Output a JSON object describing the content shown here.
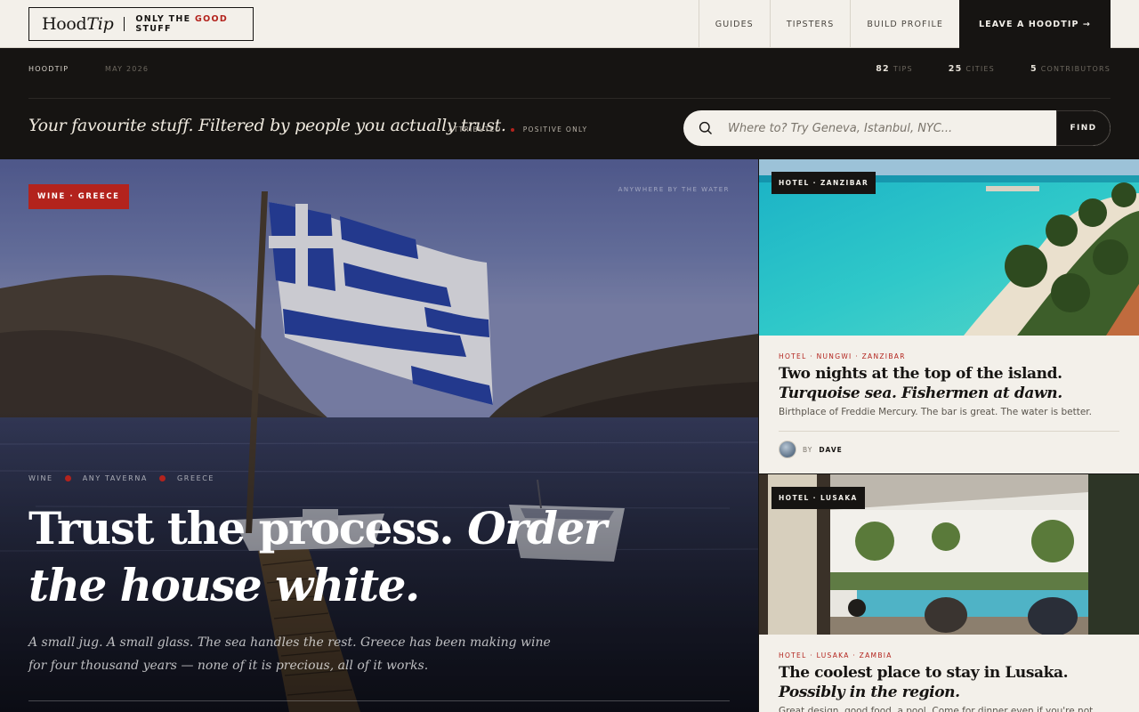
{
  "nav": {
    "logo_word": "Hood",
    "logo_word_italic": "Tip",
    "logo_tag_before": "ONLY THE ",
    "logo_tag_accent": "GOOD",
    "logo_tag_after": " STUFF",
    "items": [
      "GUIDES",
      "TIPSTERS",
      "BUILD PROFILE"
    ],
    "cta": "LEAVE A HOODTIP →"
  },
  "meta": {
    "brand": "HOODTIP",
    "date": "MAY 2026",
    "stats": [
      {
        "value": "82",
        "label": "TIPS"
      },
      {
        "value": "25",
        "label": "CITIES"
      },
      {
        "value": "5",
        "label": "CONTRIBUTORS"
      }
    ],
    "tagline": "Your favourite stuff. Filtered by people you actually trust.",
    "flags": [
      "ATTRIBUTED",
      "POSITIVE ONLY"
    ]
  },
  "search": {
    "placeholder": "Where to? Try Geneva, Istanbul, NYC...",
    "button": "FIND"
  },
  "hero": {
    "badge": "WINE · GREECE",
    "corner": "ANYWHERE BY THE WATER",
    "crumbs": [
      "WINE",
      "ANY TAVERNA",
      "GREECE"
    ],
    "title_regular": "Trust the process. ",
    "title_italic": "Order the house white.",
    "subtitle": "A small jug. A small glass. The sea handles the rest. Greece has been making wine for four thousand years — none of it is precious, all of it works."
  },
  "cards": [
    {
      "badge": "HOTEL · ZANZIBAR",
      "kicker": "HOTEL · NUNGWI · ZANZIBAR",
      "title_regular": "Two nights at the top of the island. ",
      "title_italic": "Turquoise sea. Fishermen at dawn.",
      "desc": "Birthplace of Freddie Mercury. The bar is great. The water is better.",
      "by": "BY",
      "author": "DAVE"
    },
    {
      "badge": "HOTEL · LUSAKA",
      "kicker": "HOTEL · LUSAKA · ZAMBIA",
      "title_regular": "The coolest place to stay in Lusaka. ",
      "title_italic": "Possibly in the region.",
      "desc": "Great design, good food, a pool. Come for dinner even if you're not"
    }
  ],
  "colors": {
    "accent_red": "#b3231d",
    "ink": "#161412",
    "paper": "#f3f0ea"
  }
}
